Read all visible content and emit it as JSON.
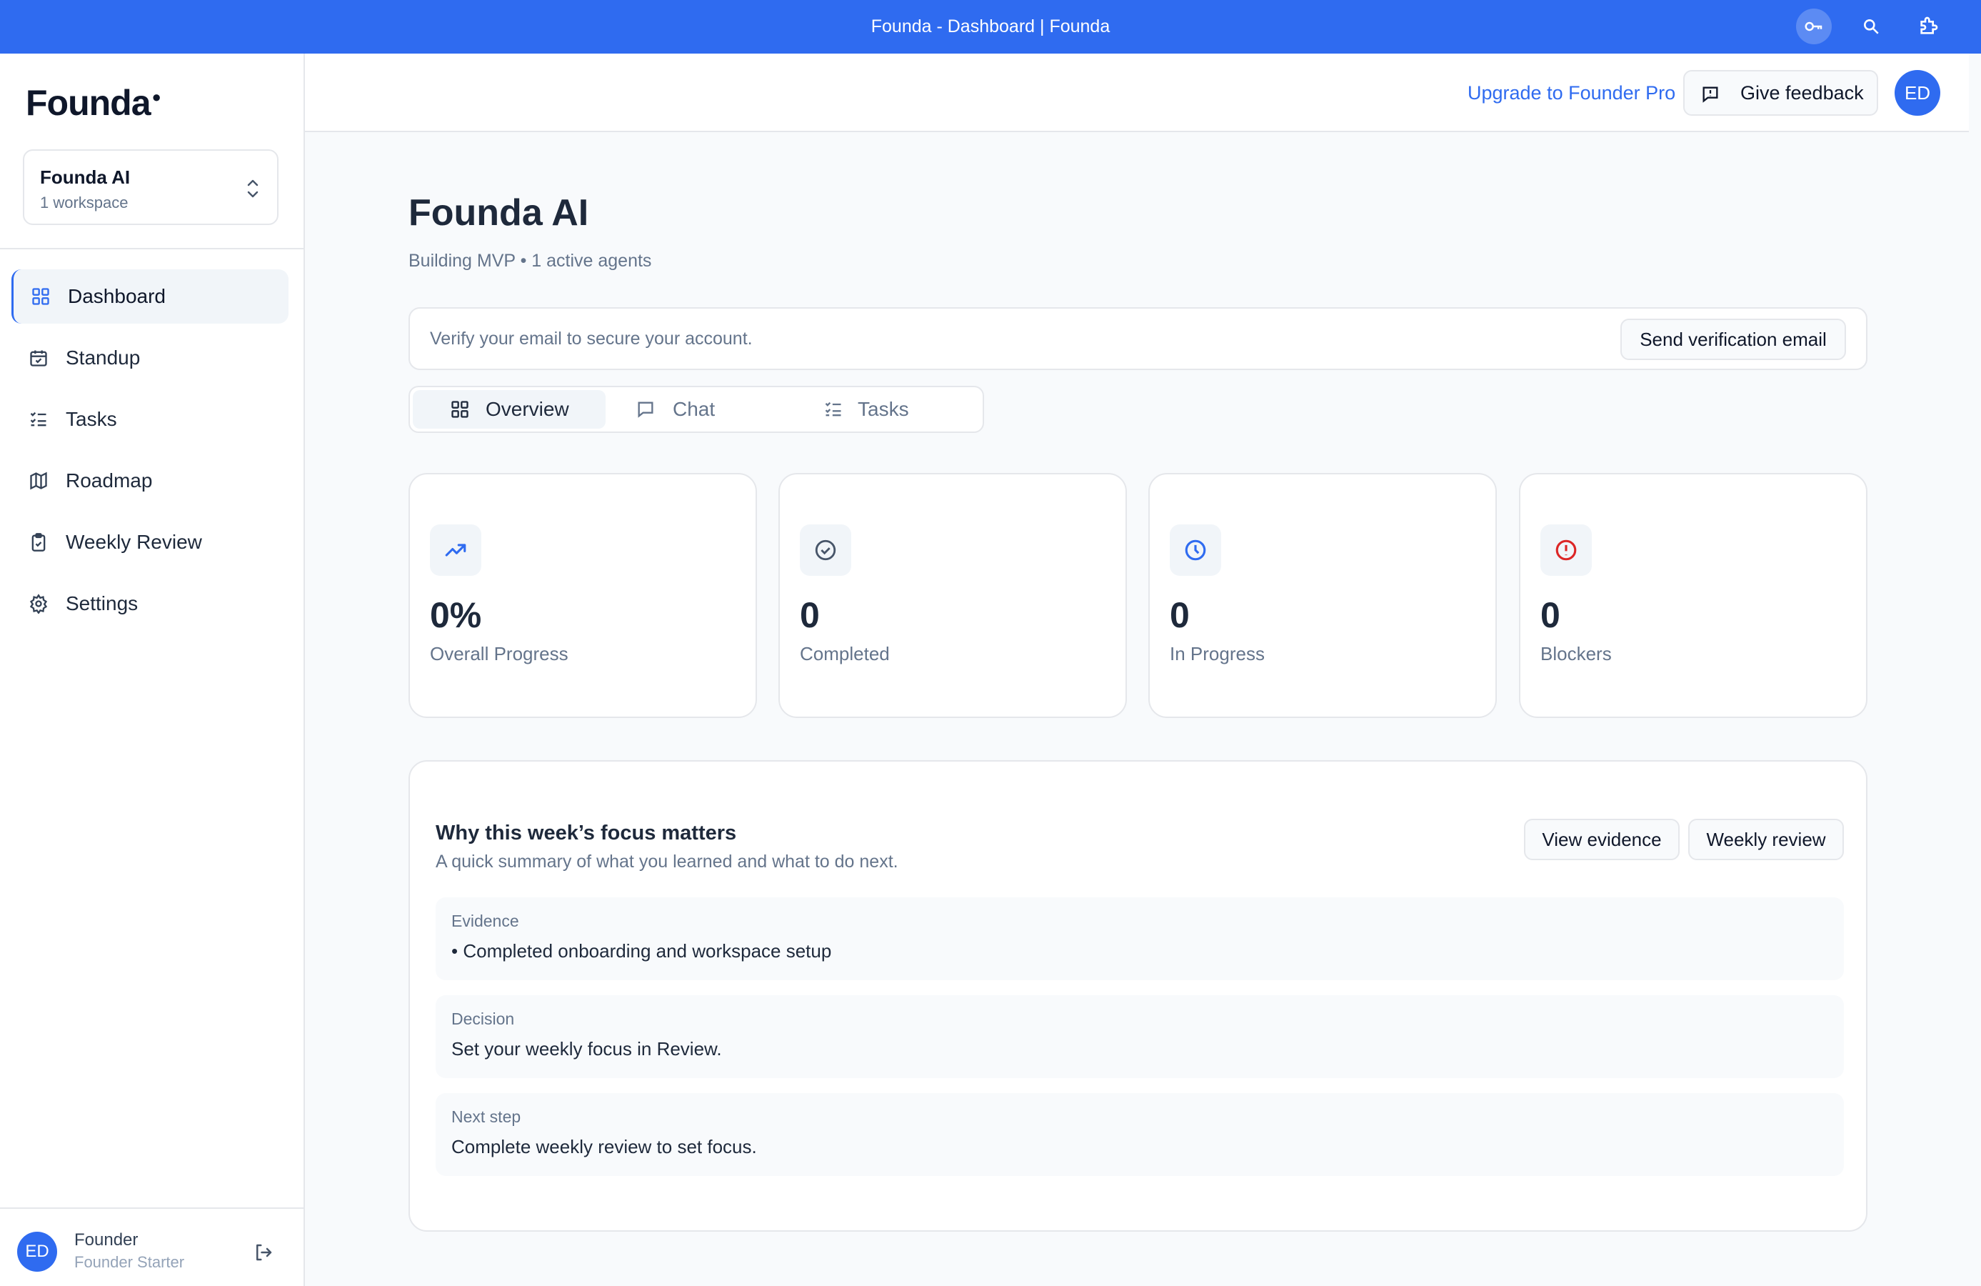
{
  "window": {
    "title": "Founda - Dashboard | Founda"
  },
  "sidebar": {
    "logo": "Founda",
    "workspace": {
      "name": "Founda AI",
      "count": "1 workspace"
    },
    "items": [
      {
        "label": "Dashboard",
        "icon": "grid-icon",
        "active": true
      },
      {
        "label": "Standup",
        "icon": "calendar-check-icon",
        "active": false
      },
      {
        "label": "Tasks",
        "icon": "list-checks-icon",
        "active": false
      },
      {
        "label": "Roadmap",
        "icon": "map-icon",
        "active": false
      },
      {
        "label": "Weekly Review",
        "icon": "clipboard-check-icon",
        "active": false
      },
      {
        "label": "Settings",
        "icon": "gear-icon",
        "active": false
      }
    ],
    "footer": {
      "avatar_initials": "ED",
      "name": "Founder",
      "plan": "Founder Starter"
    }
  },
  "header": {
    "upgrade_label": "Upgrade to Founder Pro",
    "feedback_label": "Give feedback",
    "avatar_initials": "ED"
  },
  "main": {
    "title": "Founda AI",
    "subtitle": "Building MVP • 1 active agents",
    "verify": {
      "message": "Verify your email to secure your account.",
      "button_label": "Send verification email"
    },
    "tabs": [
      {
        "label": "Overview",
        "active": true
      },
      {
        "label": "Chat",
        "active": false
      },
      {
        "label": "Tasks",
        "active": false
      }
    ],
    "stats": [
      {
        "value": "0%",
        "label": "Overall Progress",
        "icon": "trending-up-icon",
        "color": "#2f6bf0"
      },
      {
        "value": "0",
        "label": "Completed",
        "icon": "check-circle-icon",
        "color": "#475569"
      },
      {
        "value": "0",
        "label": "In Progress",
        "icon": "clock-icon",
        "color": "#2f6bf0"
      },
      {
        "value": "0",
        "label": "Blockers",
        "icon": "alert-circle-icon",
        "color": "#dc2626"
      }
    ],
    "focus": {
      "title": "Why this week’s focus matters",
      "subtitle": "A quick summary of what you learned and what to do next.",
      "view_evidence_label": "View evidence",
      "weekly_review_label": "Weekly review",
      "rows": [
        {
          "label": "Evidence",
          "value": "• Completed onboarding and workspace setup"
        },
        {
          "label": "Decision",
          "value": "Set your weekly focus in Review."
        },
        {
          "label": "Next step",
          "value": "Complete weekly review to set focus."
        }
      ]
    }
  },
  "colors": {
    "accent": "#2f6bf0",
    "danger": "#dc2626",
    "background": "#f8fafc"
  }
}
